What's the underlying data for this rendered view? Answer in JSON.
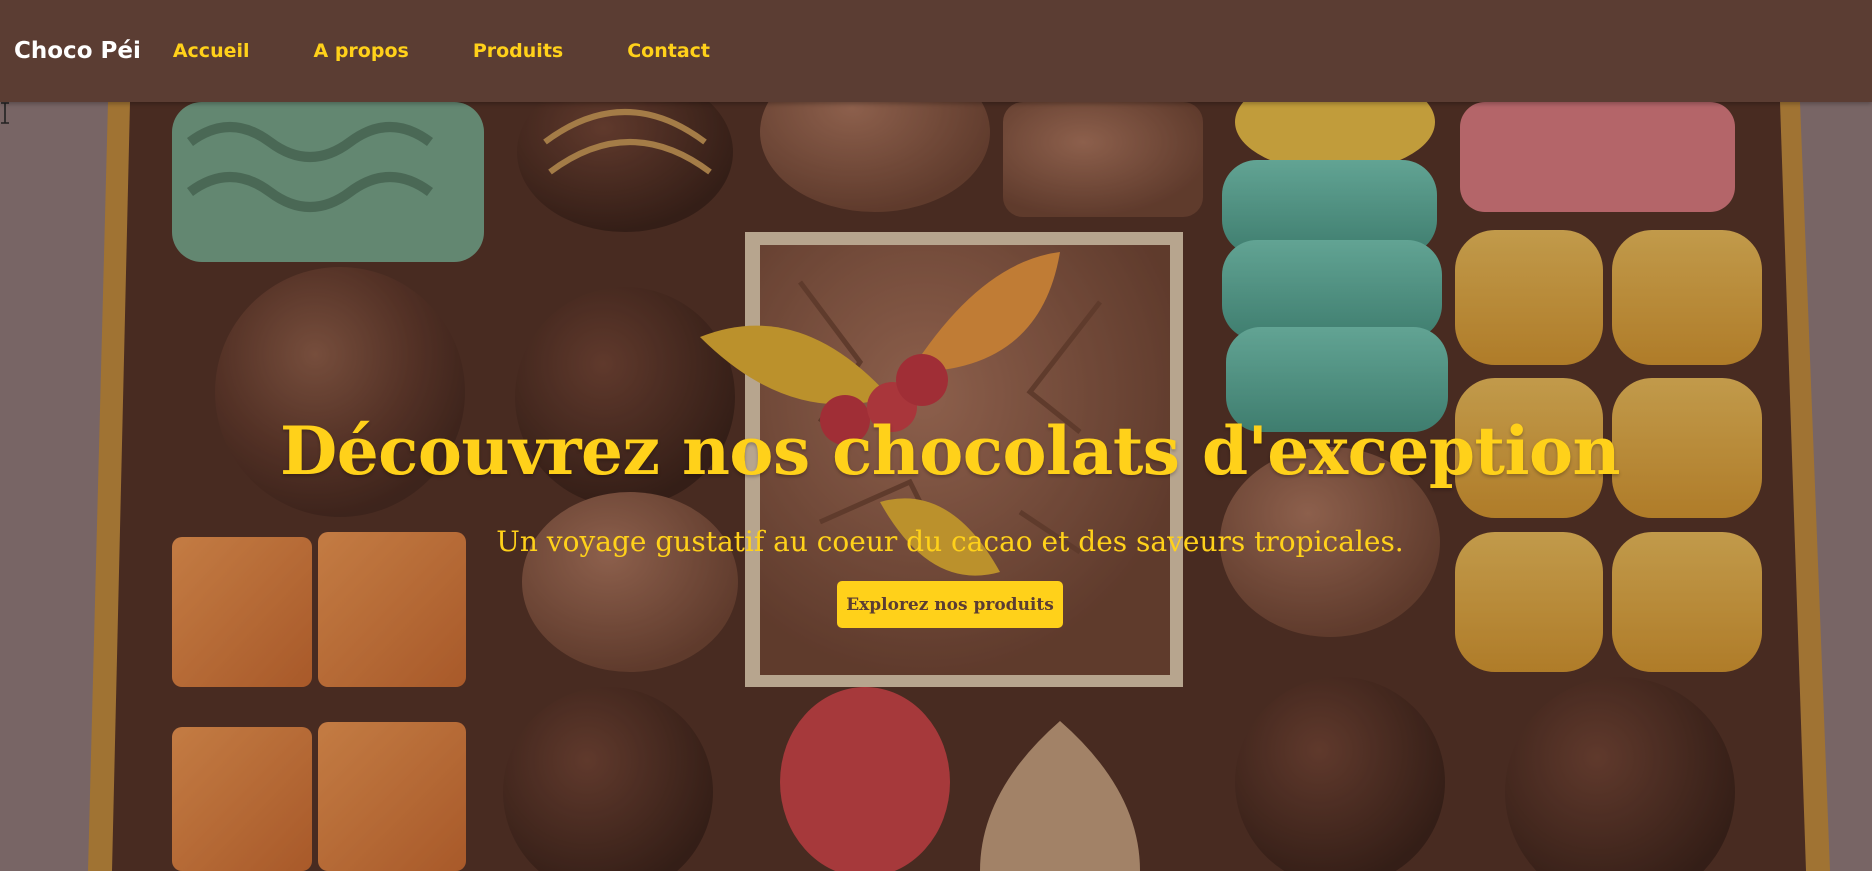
{
  "nav": {
    "brand": "Choco Péi",
    "links": [
      {
        "label": "Accueil"
      },
      {
        "label": "A propos"
      },
      {
        "label": "Produits"
      },
      {
        "label": "Contact"
      }
    ]
  },
  "hero": {
    "title": "Découvrez nos chocolats d'exception",
    "subtitle": "Un voyage gustatif au coeur du cacao et des saveurs tropicales.",
    "cta_label": "Explorez nos produits",
    "background": "chocolate-box-image"
  },
  "colors": {
    "nav_bg": "#5b3d33",
    "accent": "#ffd11a",
    "brand_text": "#ffffff"
  }
}
